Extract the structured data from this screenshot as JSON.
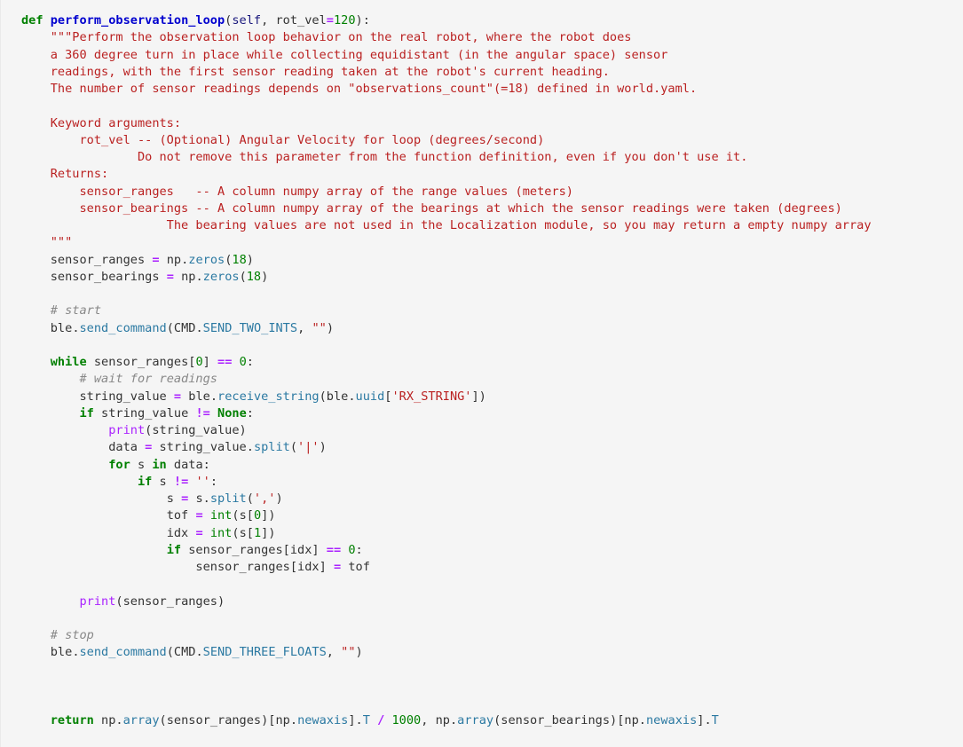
{
  "editor": {
    "background_color": "#f5f5f5",
    "language": "python",
    "font_size_px": 13.6,
    "line_height_px": 19.25,
    "colors": {
      "default_text": "#333333",
      "keyword": "#008000",
      "function_name": "#0000cf",
      "self_param": "#19177c",
      "operator": "#aa22ff",
      "number": "#008000",
      "string": "#ba2121",
      "docstring": "#ba2121",
      "comment": "#888888",
      "method_attribute": "#2b79a2",
      "builtin_int": "#008000",
      "builtin_print": "#aa22ff"
    }
  },
  "code": {
    "function_name": "perform_observation_loop",
    "lines": [
      "def perform_observation_loop(self, rot_vel=120):",
      "    \"\"\"Perform the observation loop behavior on the real robot, where the robot does",
      "    a 360 degree turn in place while collecting equidistant (in the angular space) sensor",
      "    readings, with the first sensor reading taken at the robot's current heading.",
      "    The number of sensor readings depends on \"observations_count\"(=18) defined in world.yaml.",
      "",
      "    Keyword arguments:",
      "        rot_vel -- (Optional) Angular Velocity for loop (degrees/second)",
      "                Do not remove this parameter from the function definition, even if you don't use it.",
      "    Returns:",
      "        sensor_ranges   -- A column numpy array of the range values (meters)",
      "        sensor_bearings -- A column numpy array of the bearings at which the sensor readings were taken (degrees)",
      "                    The bearing values are not used in the Localization module, so you may return a empty numpy array",
      "    \"\"\"",
      "    sensor_ranges = np.zeros(18)",
      "    sensor_bearings = np.zeros(18)",
      "",
      "    # start",
      "    ble.send_command(CMD.SEND_TWO_INTS, \"\")",
      "",
      "    while sensor_ranges[0] == 0:",
      "        # wait for readings",
      "        string_value = ble.receive_string(ble.uuid['RX_STRING'])",
      "        if string_value != None:",
      "            print(string_value)",
      "            data = string_value.split('|')",
      "            for s in data:",
      "                if s != '':",
      "                    s = s.split(',')",
      "                    tof = int(s[0])",
      "                    idx = int(s[1])",
      "                    if sensor_ranges[idx] == 0:",
      "                        sensor_ranges[idx] = tof",
      "",
      "        print(sensor_ranges)",
      "",
      "    # stop",
      "    ble.send_command(CMD.SEND_THREE_FLOATS, \"\")",
      "",
      "",
      "",
      "    return np.array(sensor_ranges)[np.newaxis].T / 1000, np.array(sensor_bearings)[np.newaxis].T"
    ],
    "comments": [
      "# start",
      "# wait for readings",
      "# stop"
    ],
    "string_literals": [
      "'RX_STRING'",
      "'|'",
      "','",
      "''",
      "\"\""
    ],
    "numbers": [
      "120",
      "18",
      "18",
      "0",
      "0",
      "1",
      "0",
      "1000"
    ],
    "keywords": [
      "def",
      "while",
      "if",
      "for",
      "in",
      "None",
      "return"
    ],
    "builtins": [
      "print",
      "int"
    ],
    "identifiers": [
      "self",
      "rot_vel",
      "sensor_ranges",
      "sensor_bearings",
      "np",
      "zeros",
      "ble",
      "send_command",
      "CMD",
      "SEND_TWO_INTS",
      "SEND_THREE_FLOATS",
      "string_value",
      "receive_string",
      "uuid",
      "data",
      "split",
      "s",
      "tof",
      "idx",
      "array",
      "newaxis",
      "T"
    ]
  }
}
